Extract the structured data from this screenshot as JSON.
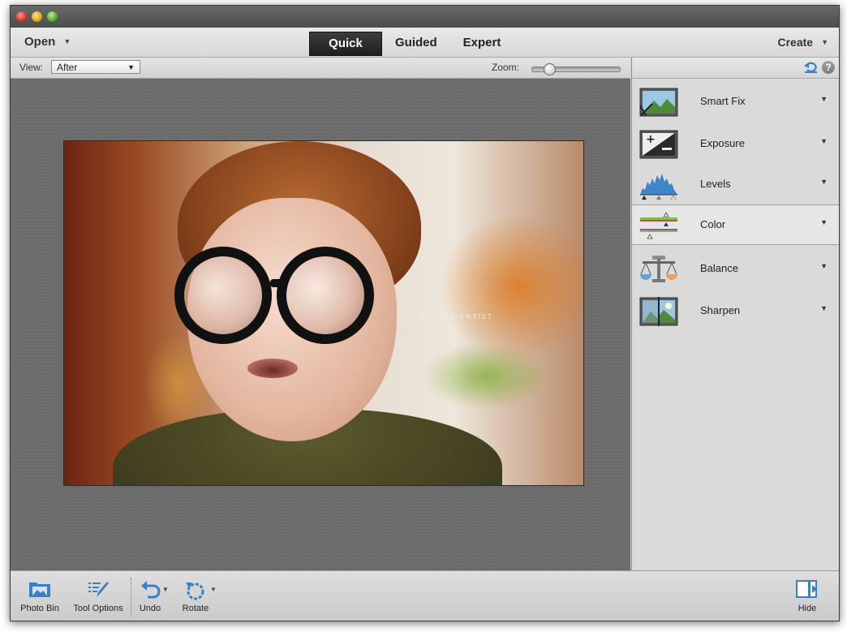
{
  "menubar": {
    "open_label": "Open",
    "modes": [
      {
        "label": "Quick",
        "active": true
      },
      {
        "label": "Guided",
        "active": false
      },
      {
        "label": "Expert",
        "active": false
      }
    ],
    "create_label": "Create"
  },
  "options_bar": {
    "view_label": "View:",
    "view_value": "After",
    "zoom_label": "Zoom:",
    "zoom_level": 0.15
  },
  "photo": {
    "overlay_text": "MAD SCIENTIST"
  },
  "panel": {
    "items": [
      {
        "label": "Smart Fix",
        "icon": "smart-fix-icon"
      },
      {
        "label": "Exposure",
        "icon": "exposure-icon"
      },
      {
        "label": "Levels",
        "icon": "levels-icon"
      },
      {
        "label": "Color",
        "icon": "color-icon",
        "selected": true
      },
      {
        "label": "Balance",
        "icon": "balance-icon"
      },
      {
        "label": "Sharpen",
        "icon": "sharpen-icon"
      }
    ]
  },
  "bottombar": {
    "photo_bin": "Photo Bin",
    "tool_options": "Tool Options",
    "undo": "Undo",
    "rotate": "Rotate",
    "hide": "Hide"
  },
  "colors": {
    "accent_blue": "#3d7fc4",
    "active_tab": "#2a2a2a",
    "canvas": "#6b6b6b"
  }
}
